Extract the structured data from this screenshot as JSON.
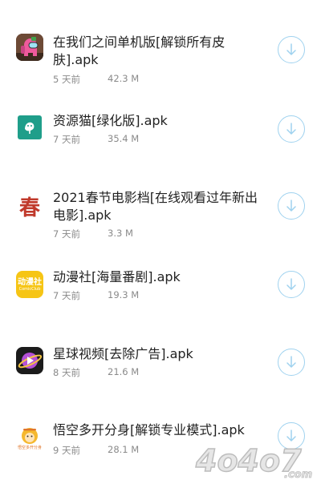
{
  "colors": {
    "title_text": "#222222",
    "meta_text": "#8a8a8a",
    "download_ring": "#9fd2ef"
  },
  "downloads": [
    {
      "title_line1": "在我们之间单机版[解锁所有皮",
      "title_line2": "肤].apk",
      "age": "5 天前",
      "size": "42.3 M",
      "icon": "among-us-crewmate-icon"
    },
    {
      "title_line1": "资源猫[绿化版].apk",
      "title_line2": "",
      "age": "7 天前",
      "size": "35.4 M",
      "icon": "cat-leaf-icon"
    },
    {
      "title_line1": "2021春节电影档[在线观看过年新出",
      "title_line2": "电影].apk",
      "age": "7 天前",
      "size": "3.3 M",
      "icon": "spring-character-icon"
    },
    {
      "title_line1": "动漫社[海量番剧].apk",
      "title_line2": "",
      "age": "7 天前",
      "size": "19.3 M",
      "icon": "anime-club-icon"
    },
    {
      "title_line1": "星球视频[去除广告].apk",
      "title_line2": "",
      "age": "8 天前",
      "size": "21.6 M",
      "icon": "planet-video-icon"
    },
    {
      "title_line1": "悟空多开分身[解锁专业模式].apk",
      "title_line2": "",
      "age": "9 天前",
      "size": "28.1 M",
      "icon": "wukong-monkey-icon"
    }
  ],
  "icon_texts": {
    "spring_glyph": "春",
    "anime_club_label": "动漫社",
    "anime_club_sub": "ComicClub",
    "wukong_caption": "悟空多开分身"
  },
  "watermark": {
    "text": "4o4o7.com",
    "big": "4o4o7",
    "small": ".com",
    "icon": "site-watermark-logo"
  }
}
